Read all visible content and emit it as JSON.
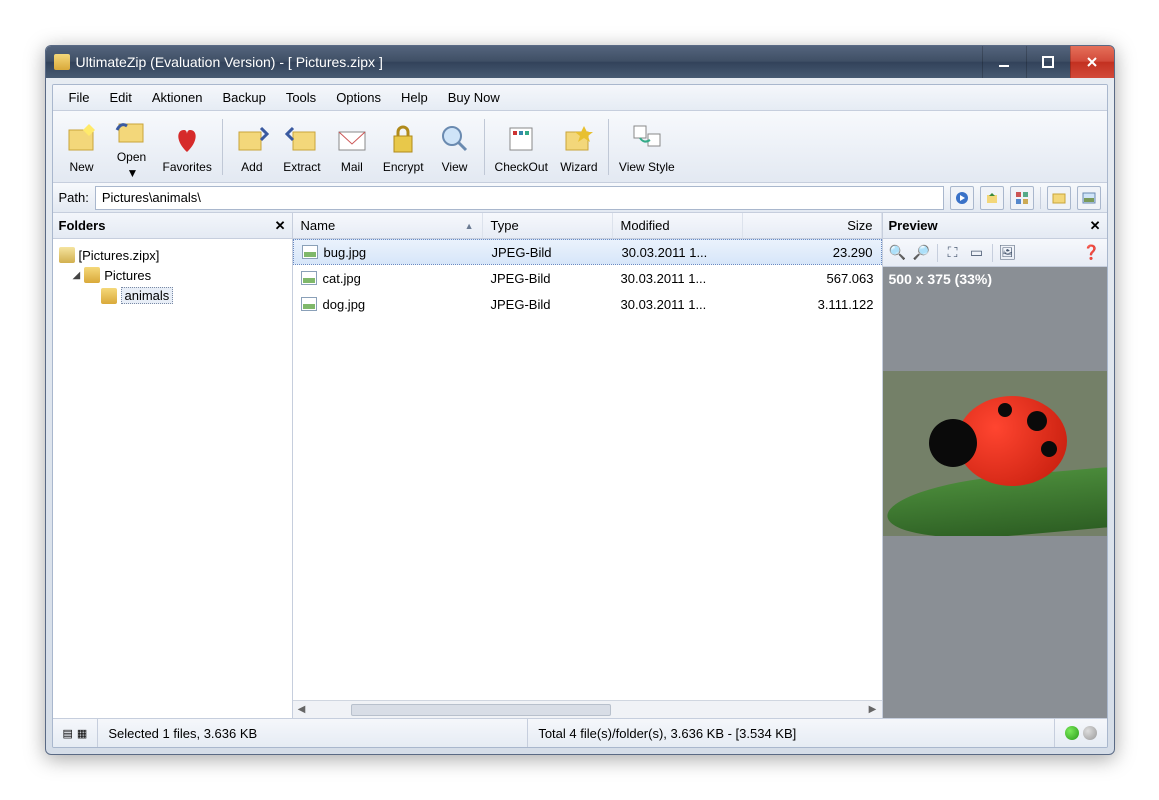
{
  "title": "UltimateZip (Evaluation Version) - [ Pictures.zipx ]",
  "menu": [
    "File",
    "Edit",
    "Aktionen",
    "Backup",
    "Tools",
    "Options",
    "Help",
    "Buy Now"
  ],
  "toolbar": {
    "new": "New",
    "open": "Open",
    "favorites": "Favorites",
    "add": "Add",
    "extract": "Extract",
    "mail": "Mail",
    "encrypt": "Encrypt",
    "view": "View",
    "checkout": "CheckOut",
    "wizard": "Wizard",
    "viewstyle": "View Style"
  },
  "path_label": "Path:",
  "path_value": "Pictures\\animals\\",
  "folders_title": "Folders",
  "tree": {
    "root": "[Pictures.zipx]",
    "level1": "Pictures",
    "level2": "animals"
  },
  "columns": {
    "name": "Name",
    "type": "Type",
    "modified": "Modified",
    "size": "Size"
  },
  "files": [
    {
      "name": "bug.jpg",
      "type": "JPEG-Bild",
      "modified": "30.03.2011 1...",
      "size": "23.290",
      "selected": true
    },
    {
      "name": "cat.jpg",
      "type": "JPEG-Bild",
      "modified": "30.03.2011 1...",
      "size": "567.063",
      "selected": false
    },
    {
      "name": "dog.jpg",
      "type": "JPEG-Bild",
      "modified": "30.03.2011 1...",
      "size": "3.111.122",
      "selected": false
    }
  ],
  "preview_title": "Preview",
  "preview_info": "500 x 375 (33%)",
  "status_selected": "Selected 1 files, 3.636 KB",
  "status_total": "Total 4 file(s)/folder(s), 3.636 KB - [3.534 KB]"
}
